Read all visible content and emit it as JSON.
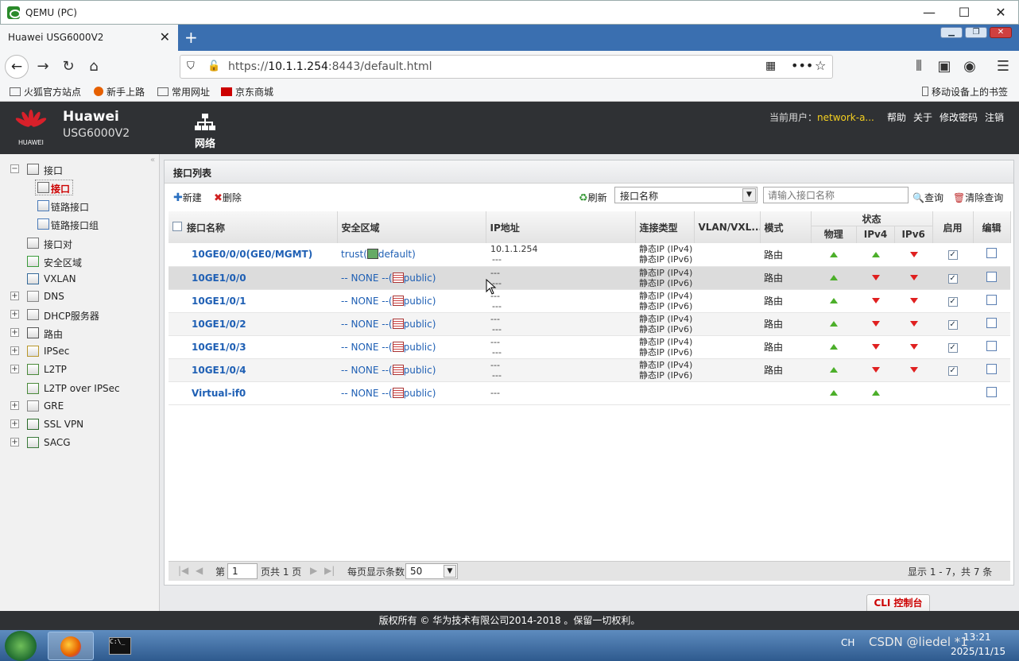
{
  "window": {
    "title": "QEMU (PC)"
  },
  "browser": {
    "tab_title": "Huawei USG6000V2",
    "url_prefix": "https://",
    "url_host": "10.1.1.254",
    "url_rest": ":8443/default.html",
    "bookmarks": [
      "火狐官方站点",
      "新手上路",
      "常用网址",
      "京东商城"
    ],
    "mobile_bookmarks": "移动设备上的书签"
  },
  "header": {
    "brand": "Huawei",
    "model": "USG6000V2",
    "logo_text": "HUAWEI",
    "nav_label": "网络",
    "user_label": "当前用户：",
    "user_name": "network-a...",
    "links": [
      "帮助",
      "关于",
      "修改密码",
      "注销"
    ]
  },
  "sidebar": {
    "items": [
      {
        "label": "接口",
        "level": 0,
        "expand": "−",
        "icon": "interface-icon"
      },
      {
        "label": "接口",
        "level": 1,
        "selected": true,
        "icon": "interface-icon"
      },
      {
        "label": "链路接口",
        "level": 1,
        "icon": "link-icon"
      },
      {
        "label": "链路接口组",
        "level": 1,
        "icon": "link-group-icon"
      },
      {
        "label": "接口对",
        "level": 0,
        "icon": "interface-pair-icon"
      },
      {
        "label": "安全区域",
        "level": 0,
        "icon": "security-zone-icon"
      },
      {
        "label": "VXLAN",
        "level": 0,
        "icon": "vxlan-icon"
      },
      {
        "label": "DNS",
        "level": 0,
        "expand": "+",
        "icon": "dns-icon"
      },
      {
        "label": "DHCP服务器",
        "level": 0,
        "expand": "+",
        "icon": "dhcp-icon"
      },
      {
        "label": "路由",
        "level": 0,
        "expand": "+",
        "icon": "route-icon"
      },
      {
        "label": "IPSec",
        "level": 0,
        "expand": "+",
        "icon": "ipsec-icon"
      },
      {
        "label": "L2TP",
        "level": 0,
        "expand": "+",
        "icon": "l2tp-icon"
      },
      {
        "label": "L2TP over IPSec",
        "level": 0,
        "icon": "l2tp-ipsec-icon"
      },
      {
        "label": "GRE",
        "level": 0,
        "expand": "+",
        "icon": "gre-icon"
      },
      {
        "label": "SSL VPN",
        "level": 0,
        "expand": "+",
        "icon": "sslvpn-icon"
      },
      {
        "label": "SACG",
        "level": 0,
        "expand": "+",
        "icon": "sacg-icon"
      }
    ]
  },
  "panel": {
    "title": "接口列表",
    "new_label": "新建",
    "delete_label": "删除",
    "refresh_label": "刷新",
    "filter_select": "接口名称",
    "search_placeholder": "请输入接口名称",
    "query_label": "查询",
    "clear_label": "清除查询"
  },
  "table": {
    "headers": {
      "name": "接口名称",
      "zone": "安全区域",
      "ip": "IP地址",
      "conn": "连接类型",
      "vlan": "VLAN/VXL...",
      "mode": "模式",
      "status": "状态",
      "phys": "物理",
      "ipv4": "IPv4",
      "ipv6": "IPv6",
      "enable": "启用",
      "edit": "编辑"
    },
    "rows": [
      {
        "name": "10GE0/0/0(GE0/MGMT)",
        "zone": "trust(",
        "zone_vs": "default)",
        "zone_icon": "green",
        "ip1": "10.1.1.254",
        "ip2": "---",
        "conn1": "静态IP (IPv4)",
        "conn2": "静态IP (IPv6)",
        "mode": "路由",
        "phys": "up",
        "ipv4": "up",
        "ipv6": "down",
        "enabled": true
      },
      {
        "name": "10GE1/0/0",
        "zone": "-- NONE --(",
        "zone_vs": "public)",
        "zone_icon": "red",
        "ip1": "---",
        "ip2": "---",
        "conn1": "静态IP (IPv4)",
        "conn2": "静态IP (IPv6)",
        "mode": "路由",
        "phys": "up",
        "ipv4": "down",
        "ipv6": "down",
        "enabled": true
      },
      {
        "name": "10GE1/0/1",
        "zone": "-- NONE --(",
        "zone_vs": "public)",
        "zone_icon": "red",
        "ip1": "---",
        "ip2": "---",
        "conn1": "静态IP (IPv4)",
        "conn2": "静态IP (IPv6)",
        "mode": "路由",
        "phys": "up",
        "ipv4": "down",
        "ipv6": "down",
        "enabled": true
      },
      {
        "name": "10GE1/0/2",
        "zone": "-- NONE --(",
        "zone_vs": "public)",
        "zone_icon": "red",
        "ip1": "---",
        "ip2": "---",
        "conn1": "静态IP (IPv4)",
        "conn2": "静态IP (IPv6)",
        "mode": "路由",
        "phys": "up",
        "ipv4": "down",
        "ipv6": "down",
        "enabled": true
      },
      {
        "name": "10GE1/0/3",
        "zone": "-- NONE --(",
        "zone_vs": "public)",
        "zone_icon": "red",
        "ip1": "---",
        "ip2": "---",
        "conn1": "静态IP (IPv4)",
        "conn2": "静态IP (IPv6)",
        "mode": "路由",
        "phys": "up",
        "ipv4": "down",
        "ipv6": "down",
        "enabled": true
      },
      {
        "name": "10GE1/0/4",
        "zone": "-- NONE --(",
        "zone_vs": "public)",
        "zone_icon": "red",
        "ip1": "---",
        "ip2": "---",
        "conn1": "静态IP (IPv4)",
        "conn2": "静态IP (IPv6)",
        "mode": "路由",
        "phys": "up",
        "ipv4": "down",
        "ipv6": "down",
        "enabled": true
      },
      {
        "name": "Virtual-if0",
        "zone": "-- NONE --(",
        "zone_vs": "public)",
        "zone_icon": "red",
        "ip1": "---",
        "ip2": "",
        "conn1": "",
        "conn2": "",
        "mode": "",
        "phys": "up",
        "ipv4": "up",
        "ipv6": "",
        "enabled": null
      }
    ]
  },
  "pager": {
    "page_prefix": "第",
    "page_value": "1",
    "page_suffix": "页共 1 页",
    "per_page_label": "每页显示条数",
    "per_page_value": "50",
    "summary": "显示 1 - 7，共 7 条"
  },
  "cli_label": "CLI 控制台",
  "footer": "版权所有 © 华为技术有限公司2014-2018 。保留一切权利。",
  "taskbar": {
    "lang": "CH",
    "time": "13:21",
    "date": "2025/11/15",
    "watermark": "CSDN @liedel *1"
  }
}
